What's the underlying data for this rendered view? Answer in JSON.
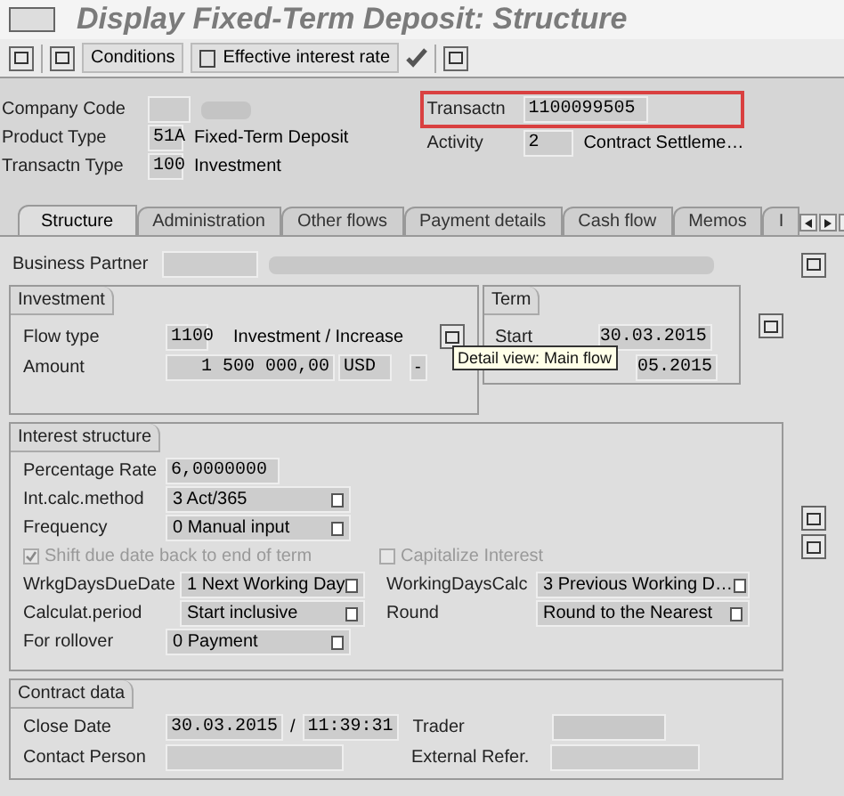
{
  "title": "Display Fixed-Term Deposit: Structure",
  "toolbar": {
    "buttons": [
      "Conditions",
      "Effective interest rate"
    ]
  },
  "header": {
    "company_code": {
      "label": "Company Code"
    },
    "product_type": {
      "label": "Product Type",
      "code": "51A",
      "text": "Fixed-Term Deposit"
    },
    "transaction_type": {
      "label": "Transactn Type",
      "code": "100",
      "text": "Investment"
    },
    "transaction": {
      "label": "Transactn",
      "value": "1100099505"
    },
    "activity": {
      "label": "Activity",
      "code": "2",
      "text": "Contract Settleme…"
    }
  },
  "tabs": [
    {
      "label": "Structure",
      "selected": true
    },
    {
      "label": "Administration",
      "selected": false
    },
    {
      "label": "Other flows",
      "selected": false
    },
    {
      "label": "Payment details",
      "selected": false
    },
    {
      "label": "Cash flow",
      "selected": false
    },
    {
      "label": "Memos",
      "selected": false
    },
    {
      "label": "I",
      "selected": false
    }
  ],
  "business_partner": {
    "label": "Business Partner"
  },
  "investment": {
    "title": "Investment",
    "flow_type": {
      "label": "Flow type",
      "code": "1100",
      "text": "Investment / Increase"
    },
    "amount": {
      "label": "Amount",
      "value": "1 500 000,00",
      "currency": "USD",
      "sign": "-"
    }
  },
  "term": {
    "title": "Term",
    "start": {
      "label": "Start",
      "value": "30.03.2015"
    },
    "end": {
      "value": "05.2015"
    }
  },
  "tooltip": "Detail view: Main flow",
  "interest": {
    "title": "Interest structure",
    "rows": [
      {
        "label": "Percentage Rate",
        "value": "6,0000000",
        "kind": "text"
      },
      {
        "label": "Int.calc.method",
        "value": "3 Act/365",
        "kind": "select"
      },
      {
        "label": "Frequency",
        "value": "0 Manual input",
        "kind": "select"
      }
    ],
    "checkboxes": [
      {
        "label": "Shift due date back to end of term",
        "checked": true,
        "disabled": true
      },
      {
        "label": "Capitalize Interest",
        "checked": false,
        "disabled": true
      }
    ],
    "pairs": [
      {
        "label": "WrkgDaysDueDate",
        "value": "1 Next Working Day",
        "label2": "WorkingDaysCalc",
        "value2": "3 Previous Working D…"
      },
      {
        "label": "Calculat.period",
        "value": "Start inclusive",
        "label2": "Round",
        "value2": "Round to the Nearest"
      }
    ],
    "rollover": {
      "label": "For rollover",
      "value": "0 Payment"
    }
  },
  "contract": {
    "title": "Contract data",
    "close_date": {
      "label": "Close Date",
      "date": "30.03.2015",
      "separator": "/",
      "time": "11:39:31"
    },
    "trader": {
      "label": "Trader"
    },
    "contact": {
      "label": "Contact Person"
    },
    "external": {
      "label": "External Refer."
    }
  }
}
